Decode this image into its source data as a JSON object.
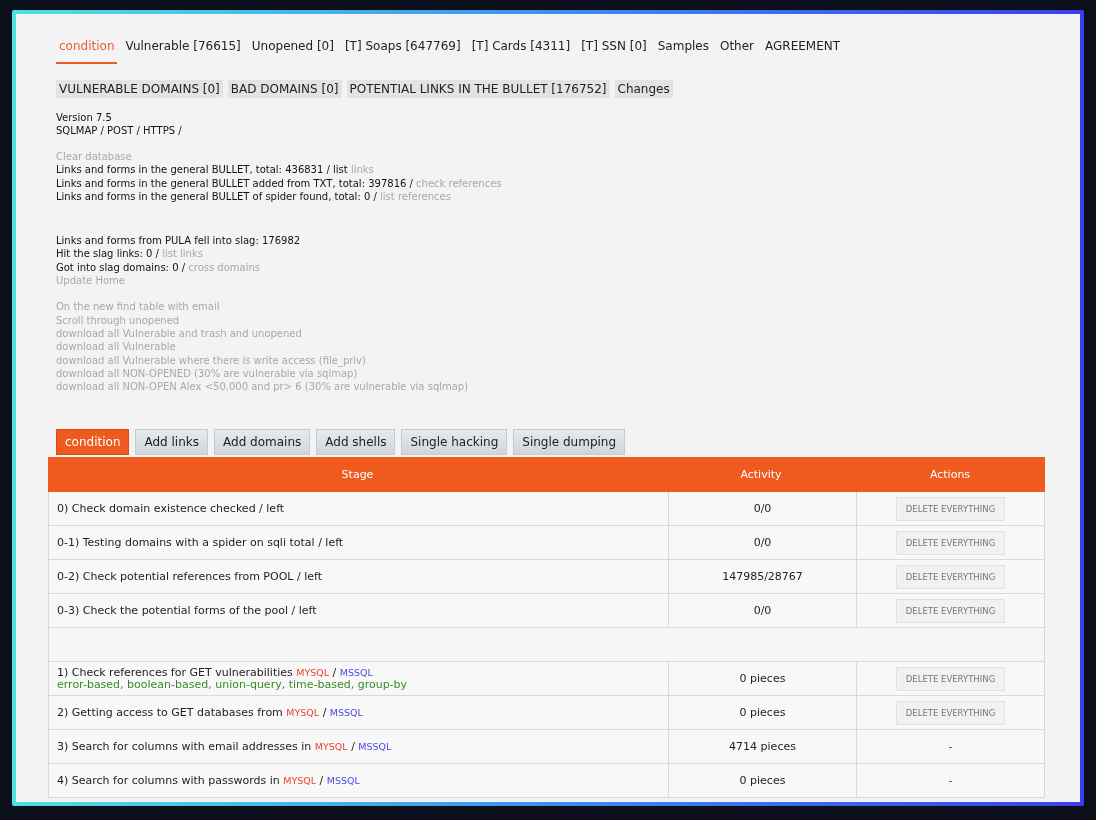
{
  "top_tabs": [
    {
      "label": "condition",
      "selected": true
    },
    {
      "label": "Vulnerable [76615]",
      "selected": false
    },
    {
      "label": "Unopened [0]",
      "selected": false
    },
    {
      "label": "[T] Soaps [647769]",
      "selected": false
    },
    {
      "label": "[T] Cards [4311]",
      "selected": false
    },
    {
      "label": "[T] SSN [0]",
      "selected": false
    },
    {
      "label": "Samples",
      "selected": false
    },
    {
      "label": "Other",
      "selected": false
    },
    {
      "label": "AGREEMENT",
      "selected": false
    }
  ],
  "sub_tabs": [
    "VULNERABLE DOMAINS [0]",
    "BAD DOMAINS [0]",
    "POTENTIAL LINKS IN THE BULLET [176752]",
    "Changes"
  ],
  "version": "Version 7.5",
  "modes": "SQLMAP / POST / HTTPS /",
  "groups": [
    [
      {
        "kind": "link",
        "text": "Clear database"
      },
      {
        "kind": "text",
        "text": "Links and forms in the general BULLET, total: 436831 / list",
        "link": "links"
      },
      {
        "kind": "text",
        "text": "Links and forms in the general BULLET added from TXT, total: 397816 /",
        "link": "check references"
      },
      {
        "kind": "text",
        "text": "Links and forms in the general BULLET of spider found, total: 0 /",
        "link": "list references"
      }
    ],
    [
      {
        "kind": "text",
        "text": "Links and forms from PULA fell into slag: 176982"
      },
      {
        "kind": "text",
        "text": "Hit the slag links: 0 /",
        "link": "list links"
      },
      {
        "kind": "text",
        "text": "Got into slag domains: 0 /",
        "link": "cross domains"
      },
      {
        "kind": "link",
        "text": "Update Home"
      }
    ],
    [
      {
        "kind": "link",
        "text": "On the new find table with email"
      },
      {
        "kind": "link",
        "text": "Scroll through unopened"
      },
      {
        "kind": "link",
        "text": "download all Vulnerable and trash and unopened"
      },
      {
        "kind": "link",
        "text": "download all Vulnerable"
      },
      {
        "kind": "link",
        "text": "download all Vulnerable where there is write access (file_priv)"
      },
      {
        "kind": "link",
        "text": "download all NON-OPENED (30% are vulnerable via sqlmap)"
      },
      {
        "kind": "link",
        "text": "download all NON-OPEN Alex <50,000 and pr> 6 (30% are vulnerable via sqlmap)"
      }
    ]
  ],
  "panel_tabs": [
    {
      "label": "condition",
      "selected": true
    },
    {
      "label": "Add links",
      "selected": false
    },
    {
      "label": "Add domains",
      "selected": false
    },
    {
      "label": "Add shells",
      "selected": false
    },
    {
      "label": "Single hacking",
      "selected": false
    },
    {
      "label": "Single dumping",
      "selected": false
    }
  ],
  "table": {
    "columns": [
      "Stage",
      "Activity",
      "Actions"
    ],
    "rows": [
      {
        "kind": "stage",
        "stage": [
          {
            "text": "0) Check domain existence checked / left"
          }
        ],
        "activity": "0/0",
        "action": {
          "kind": "button",
          "label": "DELETE EVERYTHING"
        }
      },
      {
        "kind": "stage",
        "stage": [
          {
            "text": "0-1) Testing domains with a spider on sqli total / left"
          }
        ],
        "activity": "0/0",
        "action": {
          "kind": "button",
          "label": "DELETE EVERYTHING"
        }
      },
      {
        "kind": "stage",
        "stage": [
          {
            "text": "0-2) Check potential references from POOL / left"
          }
        ],
        "activity": "147985/28767",
        "action": {
          "kind": "button",
          "label": "DELETE EVERYTHING"
        }
      },
      {
        "kind": "stage",
        "stage": [
          {
            "text": "0-3) Check the potential forms of the pool / left"
          }
        ],
        "activity": "0/0",
        "action": {
          "kind": "button",
          "label": "DELETE EVERYTHING"
        }
      },
      {
        "kind": "spacer"
      },
      {
        "kind": "stage",
        "stage": [
          {
            "text": "1) Check references for GET vulnerabilities "
          },
          {
            "text": "MYSQL",
            "color": "#e8452c"
          },
          {
            "text": " / "
          },
          {
            "text": "MSSQL",
            "color": "#4a4ae0"
          }
        ],
        "note": "error-based, boolean-based, union-query, time-based, group-by",
        "activity": "0 pieces",
        "action": {
          "kind": "button",
          "label": "DELETE EVERYTHING"
        }
      },
      {
        "kind": "stage",
        "stage": [
          {
            "text": "2) Getting access to GET databases from "
          },
          {
            "text": "MYSQL",
            "color": "#e8452c"
          },
          {
            "text": " / "
          },
          {
            "text": "MSSQL",
            "color": "#4a4ae0"
          }
        ],
        "activity": "0 pieces",
        "action": {
          "kind": "button",
          "label": "DELETE EVERYTHING"
        }
      },
      {
        "kind": "stage",
        "stage": [
          {
            "text": "3) Search for columns with email addresses in "
          },
          {
            "text": "MYSQL",
            "color": "#e8452c"
          },
          {
            "text": " / "
          },
          {
            "text": "MSSQL",
            "color": "#4a4ae0"
          }
        ],
        "activity": "4714 pieces",
        "action": {
          "kind": "text",
          "label": "-"
        }
      },
      {
        "kind": "stage",
        "stage": [
          {
            "text": "4) Search for columns with passwords in "
          },
          {
            "text": "MYSQL",
            "color": "#e8452c"
          },
          {
            "text": " / "
          },
          {
            "text": "MSSQL",
            "color": "#4a4ae0"
          }
        ],
        "activity": "0 pieces",
        "action": {
          "kind": "text",
          "label": "-"
        }
      }
    ]
  }
}
